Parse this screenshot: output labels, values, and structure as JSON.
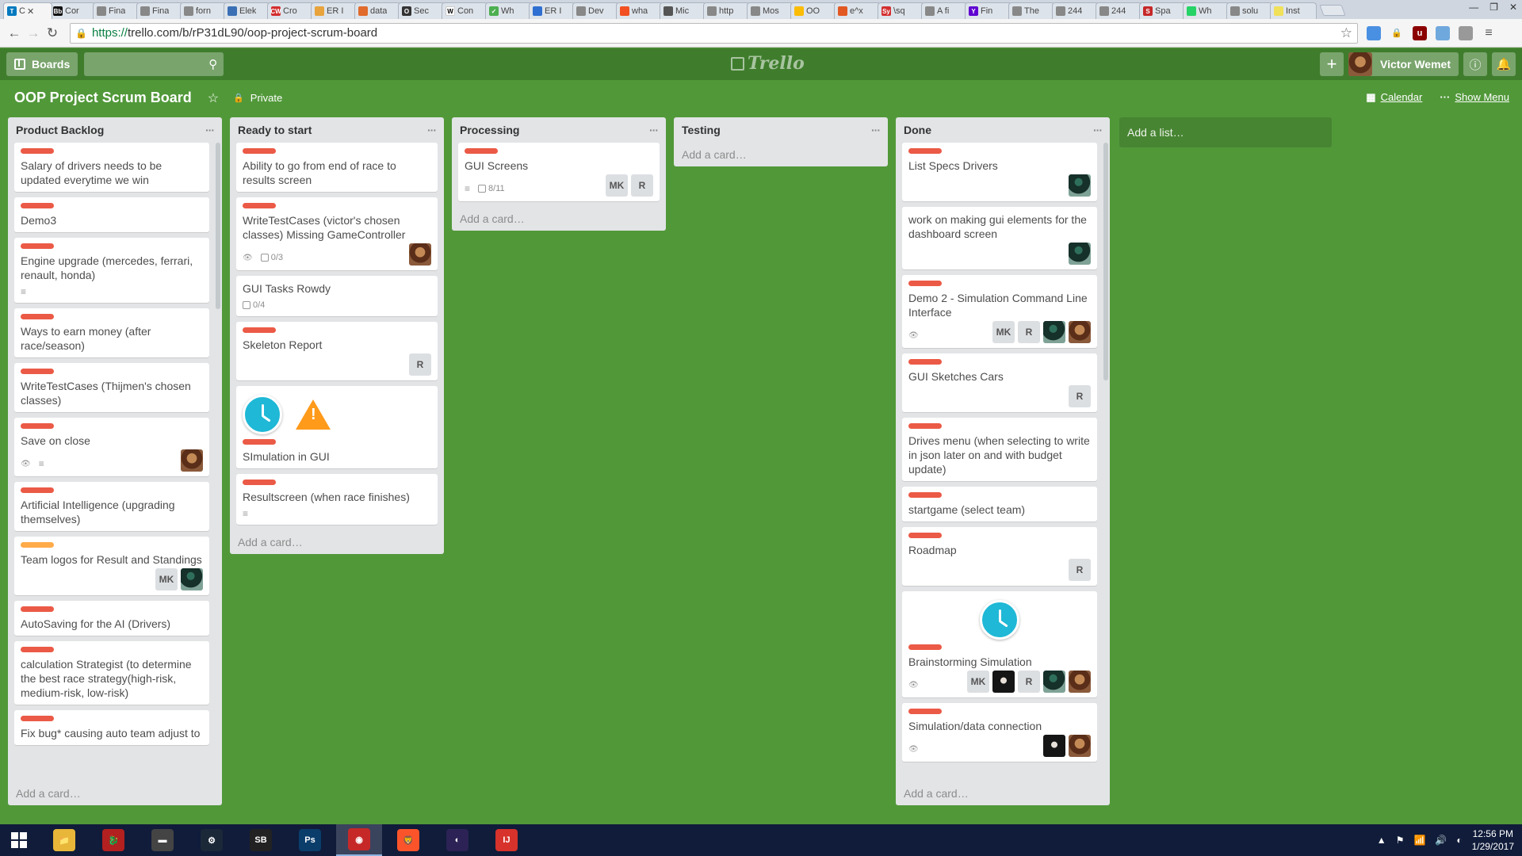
{
  "browser": {
    "tabs": [
      {
        "label": "C",
        "color": "#0079bf",
        "icon": "T",
        "active": true
      },
      {
        "label": "Cor",
        "color": "#111",
        "icon": "Bb"
      },
      {
        "label": "Fina",
        "color": "#888",
        "icon": ""
      },
      {
        "label": "Fina",
        "color": "#888",
        "icon": ""
      },
      {
        "label": "forn",
        "color": "#888",
        "icon": ""
      },
      {
        "label": "Elek",
        "color": "#3a6fb5",
        "icon": ""
      },
      {
        "label": "Cro",
        "color": "#d32f2f",
        "icon": "CW"
      },
      {
        "label": "ER I",
        "color": "#e8a33c",
        "icon": ""
      },
      {
        "label": "data",
        "color": "#e06b2c",
        "icon": ""
      },
      {
        "label": "Sec",
        "color": "#333",
        "icon": "O"
      },
      {
        "label": "Con",
        "color": "#fff",
        "icon": "W"
      },
      {
        "label": "Wh",
        "color": "#4caf50",
        "icon": "✓"
      },
      {
        "label": "ER I",
        "color": "#2f6fd1",
        "icon": ""
      },
      {
        "label": "Dev",
        "color": "#888",
        "icon": ""
      },
      {
        "label": "wha",
        "color": "#f25022",
        "icon": ""
      },
      {
        "label": "Mic",
        "color": "#555",
        "icon": ""
      },
      {
        "label": "http",
        "color": "#888",
        "icon": ""
      },
      {
        "label": "Mos",
        "color": "#888",
        "icon": ""
      },
      {
        "label": "OO",
        "color": "#fbbc04",
        "icon": ""
      },
      {
        "label": "e^x",
        "color": "#e25822",
        "icon": ""
      },
      {
        "label": "\\sq",
        "color": "#d32f2f",
        "icon": "Sy"
      },
      {
        "label": "A fi",
        "color": "#888",
        "icon": ""
      },
      {
        "label": "Fin",
        "color": "#5f01d1",
        "icon": "Y"
      },
      {
        "label": "The",
        "color": "#888",
        "icon": ""
      },
      {
        "label": "244",
        "color": "#888",
        "icon": ""
      },
      {
        "label": "244",
        "color": "#888",
        "icon": ""
      },
      {
        "label": "Spa",
        "color": "#c62828",
        "icon": "S"
      },
      {
        "label": "Wh",
        "color": "#25d366",
        "icon": ""
      },
      {
        "label": "solu",
        "color": "#888",
        "icon": ""
      },
      {
        "label": "Inst",
        "color": "#f1e05a",
        "icon": ""
      }
    ],
    "url": "https://trello.com/b/rP31dL90/oop-project-scrum-board",
    "url_scheme": "https://",
    "url_rest": "trello.com/b/rP31dL90/oop-project-scrum-board"
  },
  "header": {
    "boards_label": "Boards",
    "logo_text": "Trello",
    "user_name": "Victor Wemet"
  },
  "board": {
    "title": "OOP Project Scrum Board",
    "visibility": "Private",
    "calendar_label": "Calendar",
    "menu_label": "Show Menu"
  },
  "lists": [
    {
      "name": "Product Backlog",
      "add_card": "Add a card…",
      "cards": [
        {
          "labels": [
            "red"
          ],
          "title": "Salary of drivers needs to be updated everytime we win"
        },
        {
          "labels": [
            "red"
          ],
          "title": "Demo3"
        },
        {
          "labels": [
            "red"
          ],
          "title": "Engine upgrade (mercedes, ferrari, renault, honda)",
          "badges": {
            "description": true
          }
        },
        {
          "labels": [
            "red"
          ],
          "title": "Ways to earn money (after race/season)"
        },
        {
          "labels": [
            "red"
          ],
          "title": "WriteTestCases (Thijmen's chosen classes)"
        },
        {
          "labels": [
            "red"
          ],
          "title": "Save on close",
          "badges": {
            "watch": true,
            "description": true
          },
          "members": [
            "face-a"
          ]
        },
        {
          "labels": [
            "red"
          ],
          "title": "Artificial Intelligence (upgrading themselves)"
        },
        {
          "labels": [
            "orange"
          ],
          "title": "Team logos for Result and Standings",
          "members": [
            "MK",
            "face-b"
          ]
        },
        {
          "labels": [
            "red"
          ],
          "title": "AutoSaving for the AI (Drivers)"
        },
        {
          "labels": [
            "red"
          ],
          "title": "calculation Strategist (to determine the best race strategy(high-risk, medium-risk, low-risk)"
        },
        {
          "labels": [
            "red"
          ],
          "title": "Fix bug* causing auto team adjust to"
        }
      ]
    },
    {
      "name": "Ready to start",
      "add_card": "Add a card…",
      "cards": [
        {
          "labels": [
            "red"
          ],
          "title": "Ability to go from end of race to results screen"
        },
        {
          "labels": [
            "red"
          ],
          "title": "WriteTestCases (victor's chosen classes) Missing GameController",
          "badges": {
            "watch": true,
            "checklist": "0/3"
          },
          "members": [
            "face-a"
          ]
        },
        {
          "labels": [],
          "title": "GUI Tasks Rowdy",
          "badges": {
            "checklist": "0/4"
          }
        },
        {
          "labels": [
            "red"
          ],
          "title": "Skeleton Report",
          "members": [
            "R"
          ]
        },
        {
          "labels": [
            "red"
          ],
          "title": "SImulation in GUI",
          "cover": [
            "clock",
            "warning"
          ]
        },
        {
          "labels": [
            "red"
          ],
          "title": "Resultscreen (when race finishes)",
          "badges": {
            "description": true
          }
        }
      ]
    },
    {
      "name": "Processing",
      "add_card": "Add a card…",
      "cards": [
        {
          "labels": [
            "red"
          ],
          "title": "GUI Screens",
          "badges": {
            "description": true,
            "checklist": "8/11"
          },
          "members": [
            "MK",
            "R"
          ]
        }
      ]
    },
    {
      "name": "Testing",
      "add_card": "Add a card…",
      "cards": []
    },
    {
      "name": "Done",
      "add_card": "Add a card…",
      "cards": [
        {
          "labels": [
            "red"
          ],
          "title": "List Specs Drivers",
          "members": [
            "face-b"
          ]
        },
        {
          "labels": [],
          "title": "work on making gui elements for the dashboard screen",
          "members": [
            "face-b"
          ]
        },
        {
          "labels": [
            "red"
          ],
          "title": "Demo 2 - Simulation Command Line Interface",
          "badges": {
            "watch": true
          },
          "members": [
            "MK",
            "R",
            "face-b",
            "face-a"
          ]
        },
        {
          "labels": [
            "red"
          ],
          "title": "GUI Sketches Cars",
          "members": [
            "R"
          ]
        },
        {
          "labels": [
            "red"
          ],
          "title": "Drives menu (when selecting to write in json later on and with budget update)"
        },
        {
          "labels": [
            "red"
          ],
          "title": "startgame (select team)"
        },
        {
          "labels": [
            "red"
          ],
          "title": "Roadmap",
          "members": [
            "R"
          ]
        },
        {
          "labels": [
            "red"
          ],
          "title": "Brainstorming Simulation",
          "cover": [
            "clock"
          ],
          "badges": {
            "watch": true
          },
          "members": [
            "MK",
            "face-c",
            "R",
            "face-b",
            "face-a"
          ]
        },
        {
          "labels": [
            "red"
          ],
          "title": "Simulation/data connection",
          "badges": {
            "watch": true
          },
          "members": [
            "face-c",
            "face-a"
          ]
        }
      ]
    }
  ],
  "add_list": "Add a list…",
  "taskbar": {
    "time": "12:56 PM",
    "date": "1/29/2017",
    "apps": [
      {
        "name": "file-explorer",
        "color": "#e8b739",
        "glyph": "📁"
      },
      {
        "name": "dragon-app",
        "color": "#b32020",
        "glyph": "🐉"
      },
      {
        "name": "terminal-app",
        "color": "#444",
        "glyph": "▬"
      },
      {
        "name": "steam-app",
        "color": "#1b2838",
        "glyph": "⚙"
      },
      {
        "name": "soundblaster-app",
        "color": "#222",
        "glyph": "SB"
      },
      {
        "name": "photoshop-app",
        "color": "#0b3d6b",
        "glyph": "Ps"
      },
      {
        "name": "browser-app",
        "color": "#c62828",
        "glyph": "◉",
        "active": true
      },
      {
        "name": "brave-app",
        "color": "#fb542b",
        "glyph": "🦁"
      },
      {
        "name": "eclipse-app",
        "color": "#2c2255",
        "glyph": "◐"
      },
      {
        "name": "intellij-app",
        "color": "#d7322b",
        "glyph": "IJ"
      }
    ]
  }
}
